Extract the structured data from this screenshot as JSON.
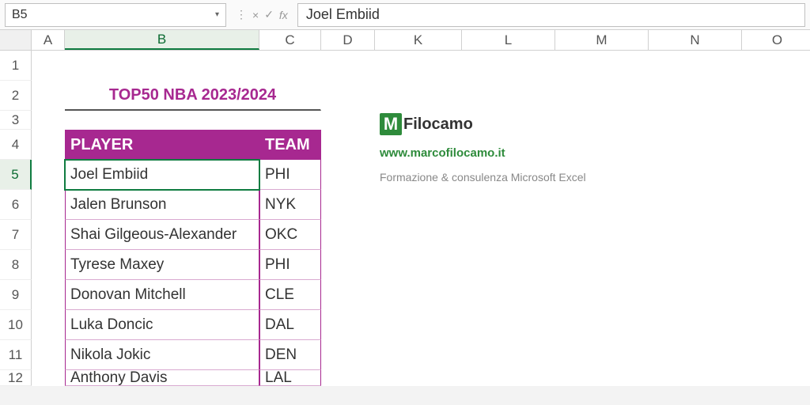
{
  "formula_bar": {
    "cell_ref": "B5",
    "cell_value": "Joel Embiid"
  },
  "columns": [
    "A",
    "B",
    "C",
    "D",
    "K",
    "L",
    "M",
    "N",
    "O"
  ],
  "rows": [
    "1",
    "2",
    "3",
    "4",
    "5",
    "6",
    "7",
    "8",
    "9",
    "10",
    "11",
    "12"
  ],
  "active_row": "5",
  "active_col": "B",
  "title": "TOP50 NBA 2023/2024",
  "table": {
    "headers": {
      "player": "PLAYER",
      "team": "TEAM"
    },
    "rows": [
      {
        "player": "Joel Embiid",
        "team": "PHI"
      },
      {
        "player": "Jalen Brunson",
        "team": "NYK"
      },
      {
        "player": "Shai Gilgeous-Alexander",
        "team": "OKC"
      },
      {
        "player": "Tyrese Maxey",
        "team": "PHI"
      },
      {
        "player": "Donovan Mitchell",
        "team": "CLE"
      },
      {
        "player": "Luka Doncic",
        "team": "DAL"
      },
      {
        "player": "Nikola Jokic",
        "team": "DEN"
      },
      {
        "player": "Anthony Davis",
        "team": "LAL"
      }
    ]
  },
  "branding": {
    "logo_letter": "M",
    "logo_name": "Filocamo",
    "website": "www.marcofilocamo.it",
    "tagline": "Formazione & consulenza Microsoft Excel"
  }
}
